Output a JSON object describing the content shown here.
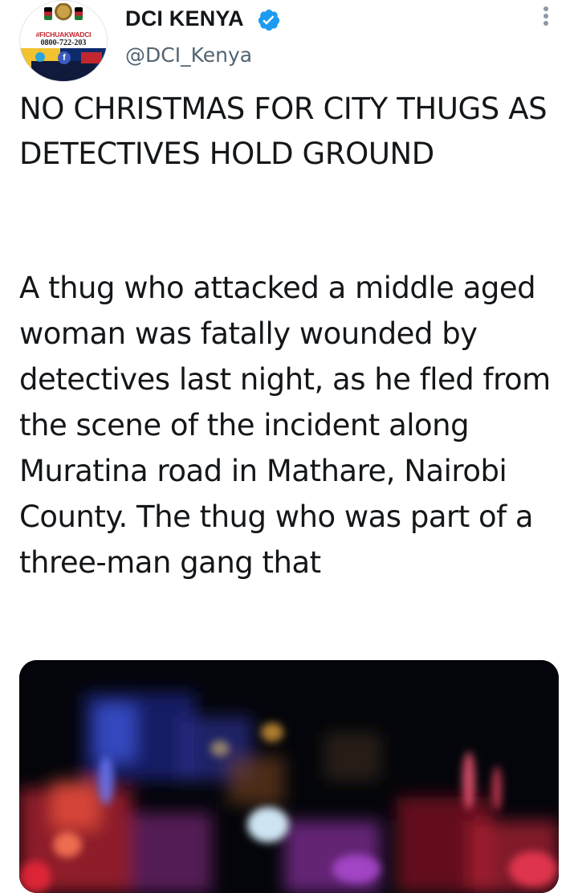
{
  "account": {
    "display_name": "DCI KENYA",
    "handle": "@DCI_Kenya",
    "verified": true,
    "verified_color": "#1d9bf0",
    "avatar": {
      "hashtag": "#FICHUAKWADCI",
      "phone": "0800-722-203"
    }
  },
  "menu": {
    "icon": "more-vertical-icon"
  },
  "tweet": {
    "headline": "NO CHRISTMAS FOR CITY THUGS AS DETECTIVES HOLD GROUND",
    "body": "A thug who attacked a middle aged woman was fatally wounded by detectives last night, as he fled from the scene of the incident along Muratina road in Mathare, Nairobi County. The thug who was part of a three-man gang that"
  },
  "media": {
    "kind": "blurred night street photo"
  },
  "colors": {
    "text": "#14171a",
    "secondary_text": "#536471",
    "background": "#ffffff"
  }
}
